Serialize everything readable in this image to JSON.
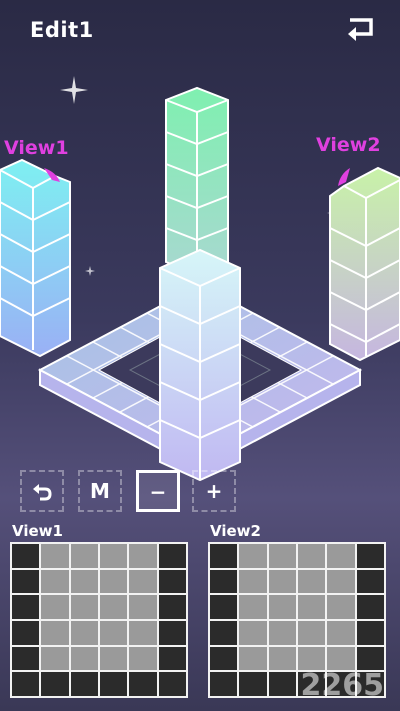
{
  "header": {
    "title": "Edit1",
    "back_icon": "return-arrow-icon"
  },
  "scene": {
    "view1_label": "View1",
    "view2_label": "View2"
  },
  "toolbar": {
    "undo_icon": "undo-arrow-icon",
    "m_label": "M",
    "minus_label": "−",
    "plus_label": "+",
    "selected": "minus"
  },
  "views": {
    "view1": {
      "title": "View1",
      "grid": [
        [
          0,
          1,
          1,
          1,
          1,
          0
        ],
        [
          0,
          1,
          1,
          1,
          1,
          0
        ],
        [
          0,
          1,
          1,
          1,
          1,
          0
        ],
        [
          0,
          1,
          1,
          1,
          1,
          0
        ],
        [
          0,
          1,
          1,
          1,
          1,
          0
        ],
        [
          0,
          0,
          0,
          0,
          0,
          0
        ]
      ]
    },
    "view2": {
      "title": "View2",
      "grid": [
        [
          0,
          1,
          1,
          1,
          1,
          0
        ],
        [
          0,
          1,
          1,
          1,
          1,
          0
        ],
        [
          0,
          1,
          1,
          1,
          1,
          0
        ],
        [
          0,
          1,
          1,
          1,
          1,
          0
        ],
        [
          0,
          1,
          1,
          1,
          1,
          0
        ],
        [
          0,
          0,
          0,
          0,
          0,
          0
        ]
      ]
    }
  },
  "colors": {
    "accent_label": "#e040e0",
    "cell_filled": "#9a9a9a",
    "cell_empty": "#2b2b2b"
  },
  "watermark": {
    "text": "2265"
  }
}
